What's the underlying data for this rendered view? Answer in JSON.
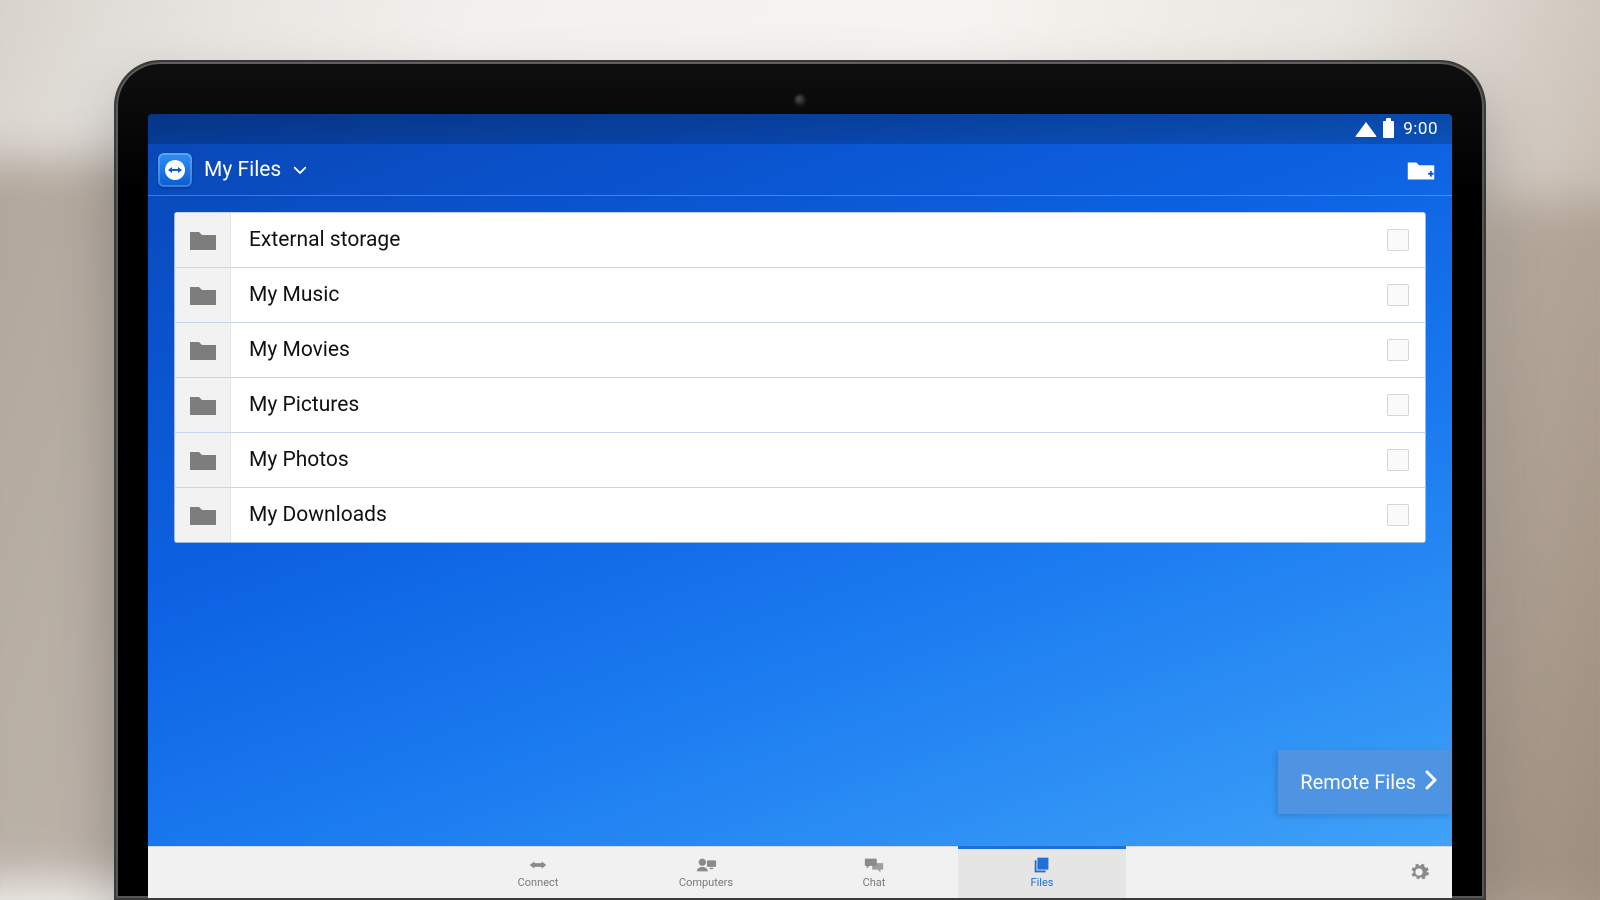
{
  "statusbar": {
    "time": "9:00"
  },
  "header": {
    "title": "My Files"
  },
  "folders": [
    {
      "label": "External storage"
    },
    {
      "label": "My Music"
    },
    {
      "label": "My Movies"
    },
    {
      "label": "My Pictures"
    },
    {
      "label": "My Photos"
    },
    {
      "label": "My Downloads"
    }
  ],
  "remote_button": {
    "label": "Remote Files"
  },
  "nav": {
    "items": [
      {
        "label": "Connect"
      },
      {
        "label": "Computers"
      },
      {
        "label": "Chat"
      },
      {
        "label": "Files"
      }
    ],
    "active_index": 3
  }
}
